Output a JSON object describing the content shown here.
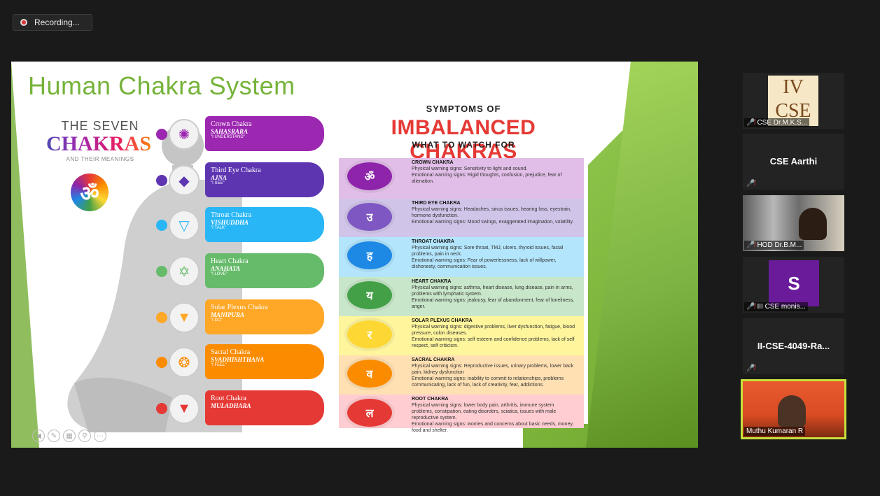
{
  "recording": {
    "label": "Recording..."
  },
  "slide": {
    "title": "Human Chakra System",
    "left_panel": {
      "heading_line1": "THE SEVEN",
      "heading_line2": "CHAKRAS",
      "heading_line3": "AND THEIR MEANINGS",
      "om_symbol": "ॐ"
    },
    "chakras": [
      {
        "name": "Crown Chakra",
        "sanskrit": "SAHASRARA",
        "meaning": "\"I UNDERSTAND\"",
        "color": "#9c27b0",
        "symbol": "✺"
      },
      {
        "name": "Third Eye Chakra",
        "sanskrit": "AJNA",
        "meaning": "\"I SEE\"",
        "color": "#5e35b1",
        "symbol": "◆"
      },
      {
        "name": "Throat Chakra",
        "sanskrit": "VISHUDDHA",
        "meaning": "\"I TALK\"",
        "color": "#29b6f6",
        "symbol": "▽"
      },
      {
        "name": "Heart Chakra",
        "sanskrit": "ANAHATA",
        "meaning": "\"I LOVE\"",
        "color": "#66bb6a",
        "symbol": "✡"
      },
      {
        "name": "Solar Plexus Chakra",
        "sanskrit": "MANIPURA",
        "meaning": "\"I DO\"",
        "color": "#ffa726",
        "symbol": "▼"
      },
      {
        "name": "Sacral Chakra",
        "sanskrit": "SVADHISHTHANA",
        "meaning": "\"I FEEL\"",
        "color": "#fb8c00",
        "symbol": "❂"
      },
      {
        "name": "Root Chakra",
        "sanskrit": "MULADHARA",
        "meaning": "",
        "color": "#e53935",
        "symbol": "▼"
      }
    ],
    "symptoms": {
      "head1": "SYMPTOMS OF",
      "head2": "IMBALANCED CHAKRAS",
      "head3": "WHAT TO WATCH FOR",
      "rows": [
        {
          "title": "CROWN CHAKRA",
          "glyph": "ॐ",
          "color": "#8e24aa",
          "bg": "#e1bee7",
          "physical": "Physical warning signs: Sensitivity to light and sound.",
          "emotional": "Emotional warning signs: Rigid thoughts, confusion, prejudice, fear of alienation."
        },
        {
          "title": "THIRD EYE CHAKRA",
          "glyph": "उ",
          "color": "#7e57c2",
          "bg": "#d1c4e9",
          "physical": "Physical warning signs: Headaches, sinus issues, hearing loss, eyestrain, hormone dysfunction.",
          "emotional": "Emotional warning signs: Mood swings, exaggerated imagination, volatility."
        },
        {
          "title": "THROAT CHAKRA",
          "glyph": "ह",
          "color": "#1e88e5",
          "bg": "#b3e5fc",
          "physical": "Physical warning signs: Sore throat, TMJ, ulcers, thyroid issues, facial problems, pain in neck.",
          "emotional": "Emotional warning signs: Fear of powerlessness, lack of willpower, dishonesty, communication issues."
        },
        {
          "title": "HEART CHAKRA",
          "glyph": "य",
          "color": "#43a047",
          "bg": "#c8e6c9",
          "physical": "Physical warning signs: asthma, heart disease, lung disease, pain in arms, problems with lymphatic system.",
          "emotional": "Emotional warning signs: jealousy, fear of abandonment, fear of loneliness, anger."
        },
        {
          "title": "SOLAR PLEXUS CHAKRA",
          "glyph": "र",
          "color": "#fdd835",
          "bg": "#fff59d",
          "physical": "Physical warning signs: digestive problems, liver dysfunction, fatigue, blood pressure, colon diseases.",
          "emotional": "Emotional warning signs: self esteem and confidence problems, lack of self respect, self criticism."
        },
        {
          "title": "SACRAL CHAKRA",
          "glyph": "व",
          "color": "#fb8c00",
          "bg": "#ffe0b2",
          "physical": "Physical warning signs: Reproductive issues, urinary problems, lower back pain, kidney dysfunction",
          "emotional": "Emotional warning signs: inability to commit to relationships, problems communicating, lack of fun, lack of creativity, fear, addictions."
        },
        {
          "title": "ROOT CHAKRA",
          "glyph": "ल",
          "color": "#e53935",
          "bg": "#ffcdd2",
          "physical": "Physical warning signs: lower body pain, arthritis, immune system problems, constipation, eating disorders, sciatica, issues with male reproductive system.",
          "emotional": "Emotional warning signs: worries and concerns about basic needs, money, food and shelter."
        }
      ]
    }
  },
  "participants": [
    {
      "name": "CSE Dr.M.K.S...",
      "type": "image",
      "card_text_1": "IV",
      "card_text_2": "CSE",
      "muted": true
    },
    {
      "name": "CSE Aarthi",
      "type": "name-only",
      "muted": true
    },
    {
      "name": "HOD Dr.B.M...",
      "type": "video",
      "muted": true
    },
    {
      "name": "III CSE monis...",
      "type": "avatar",
      "avatar_letter": "S",
      "muted": true
    },
    {
      "name": "II-CSE-4049-Ra...",
      "type": "name-only",
      "muted": true
    },
    {
      "name": "Muthu Kumaran R",
      "type": "video-active",
      "muted": false
    }
  ]
}
